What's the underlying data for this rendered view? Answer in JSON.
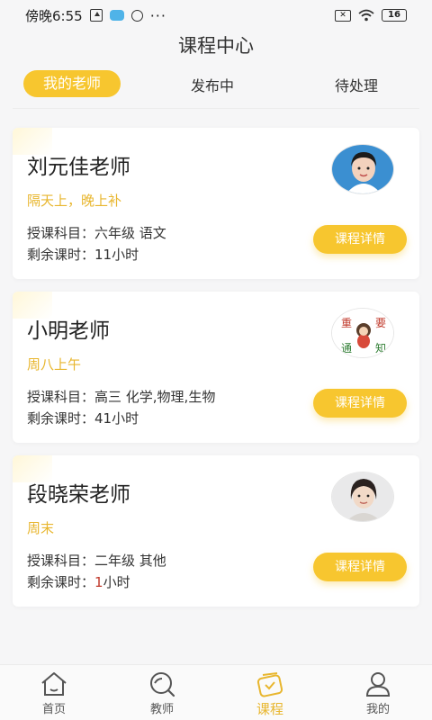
{
  "status_bar": {
    "time": "傍晚6:55",
    "battery": "16"
  },
  "header": {
    "title": "课程中心"
  },
  "tabs": [
    {
      "label": "我的老师",
      "active": true
    },
    {
      "label": "发布中",
      "active": false
    },
    {
      "label": "待处理",
      "active": false
    }
  ],
  "subject_prefix": "授课科目：",
  "remaining_prefix": "剩余课时：",
  "cards": [
    {
      "name": "刘元佳老师",
      "schedule": "隔天上，晚上补",
      "subject": "六年级 语文",
      "remaining_num": "11",
      "remaining_unit": "小时",
      "button": "课程详情"
    },
    {
      "name": "小明老师",
      "schedule": "周八上午",
      "subject": "高三 化学,物理,生物",
      "remaining_num": "41",
      "remaining_unit": "小时",
      "button": "课程详情"
    },
    {
      "name": "段晓荣老师",
      "schedule": "周末",
      "subject": "二年级 其他",
      "remaining_num": "1",
      "remaining_unit": "小时",
      "button": "课程详情"
    }
  ],
  "avatar2_chars": [
    "重",
    "要",
    "通",
    "知"
  ],
  "bottom_nav": [
    {
      "label": "首页",
      "icon": "home-icon",
      "active": false
    },
    {
      "label": "教师",
      "icon": "search-icon",
      "active": false
    },
    {
      "label": "课程",
      "icon": "course-icon",
      "active": true
    },
    {
      "label": "我的",
      "icon": "user-icon",
      "active": false
    }
  ],
  "colors": {
    "accent": "#f7c62f",
    "schedule_text": "#e8b62e",
    "background": "#f6f6f7",
    "remaining_highlight": "#c0392b"
  }
}
